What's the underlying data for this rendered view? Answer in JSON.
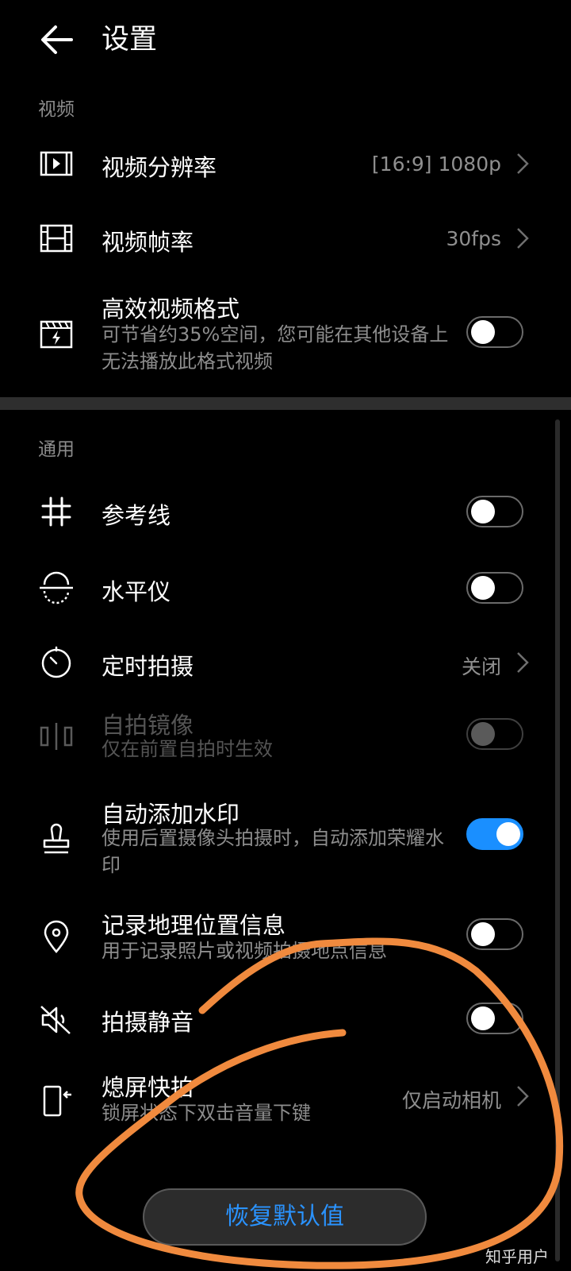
{
  "header": {
    "title": "设置"
  },
  "sections": {
    "video": "视频",
    "general": "通用"
  },
  "video": {
    "resolution": {
      "title": "视频分辨率",
      "value": "[16:9] 1080p"
    },
    "framerate": {
      "title": "视频帧率",
      "value": "30fps"
    },
    "efficient_format": {
      "title": "高效视频格式",
      "desc": "可节省约35%空间，您可能在其他设备上无法播放此格式视频",
      "enabled": false
    }
  },
  "general": {
    "grid": {
      "title": "参考线",
      "enabled": false
    },
    "level": {
      "title": "水平仪",
      "enabled": false
    },
    "timer": {
      "title": "定时拍摄",
      "value": "关闭"
    },
    "mirror": {
      "title": "自拍镜像",
      "desc": "仅在前置自拍时生效",
      "enabled": false,
      "disabled": true
    },
    "watermark": {
      "title": "自动添加水印",
      "desc": "使用后置摄像头拍摄时，自动添加荣耀水印",
      "enabled": true
    },
    "location": {
      "title": "记录地理位置信息",
      "desc": "用于记录照片或视频拍摄地点信息",
      "enabled": false
    },
    "mute": {
      "title": "拍摄静音",
      "enabled": false
    },
    "quick_snap": {
      "title": "熄屏快拍",
      "desc": "锁屏状态下双击音量下键",
      "value": "仅启动相机"
    }
  },
  "reset_button": "恢复默认值",
  "watermark_text": "知乎用户",
  "colors": {
    "accent": "#1a8fff",
    "annotation": "#f08a3e",
    "background": "#000000"
  }
}
